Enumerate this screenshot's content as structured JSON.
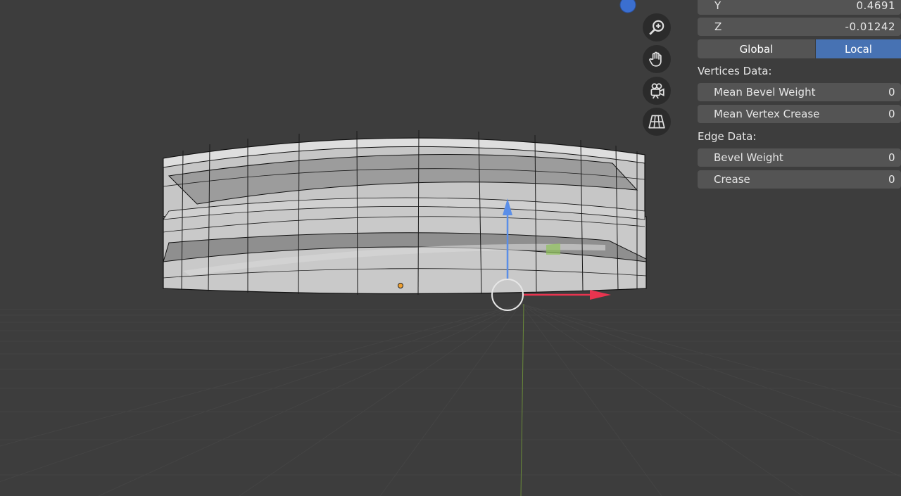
{
  "panel": {
    "y": {
      "label": "Y",
      "value": "0.4691"
    },
    "z": {
      "label": "Z",
      "value": "-0.01242"
    },
    "orientation": {
      "global": "Global",
      "local": "Local",
      "active": "Local"
    },
    "vertices_title": "Vertices Data:",
    "mean_bevel_weight": {
      "label": "Mean Bevel Weight",
      "value": "0"
    },
    "mean_vertex_crease": {
      "label": "Mean Vertex Crease",
      "value": "0"
    },
    "edge_title": "Edge Data:",
    "bevel_weight": {
      "label": "Bevel Weight",
      "value": "0"
    },
    "crease": {
      "label": "Crease",
      "value": "0"
    }
  },
  "nav": {
    "icons": [
      "zoom-icon",
      "hand-pan-icon",
      "camera-view-icon",
      "perspective-grid-icon"
    ]
  },
  "colors": {
    "background": "#3d3d3d",
    "accent": "#4772b3",
    "field": "#545454",
    "gizmo_x": "#e8344f",
    "gizmo_z": "#5a8ee8"
  }
}
